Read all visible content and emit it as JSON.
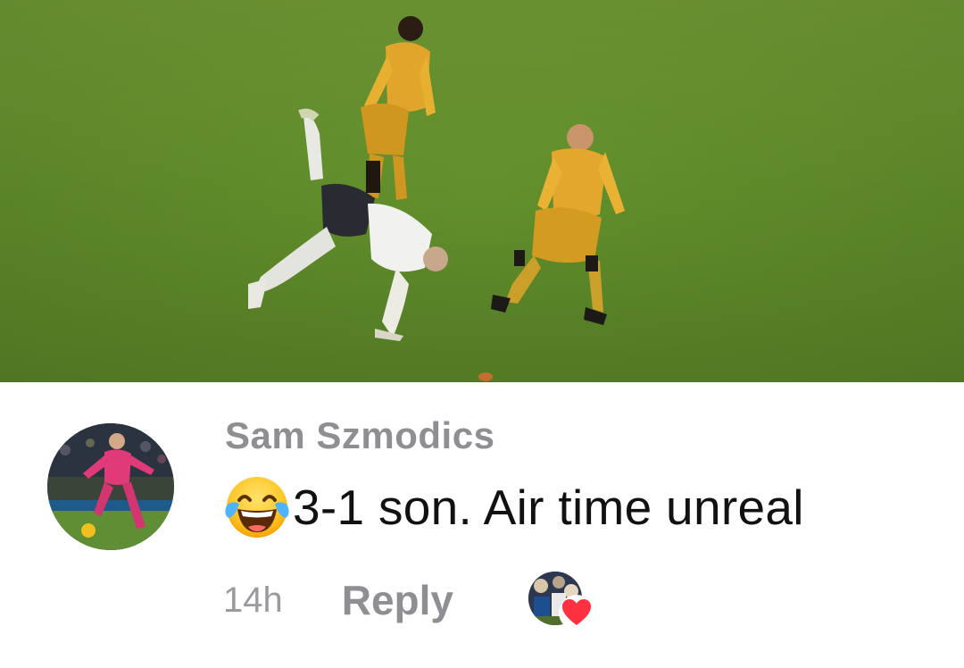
{
  "media": {
    "kind": "photo",
    "description_icon": "football-match-photo"
  },
  "comment": {
    "author": "Sam Szmodics",
    "emoji": "😂",
    "text": "3-1 son. Air time unreal",
    "timestamp": "14h",
    "reply_label": "Reply",
    "reaction": "heart",
    "reaction_color": "#ff3040"
  }
}
